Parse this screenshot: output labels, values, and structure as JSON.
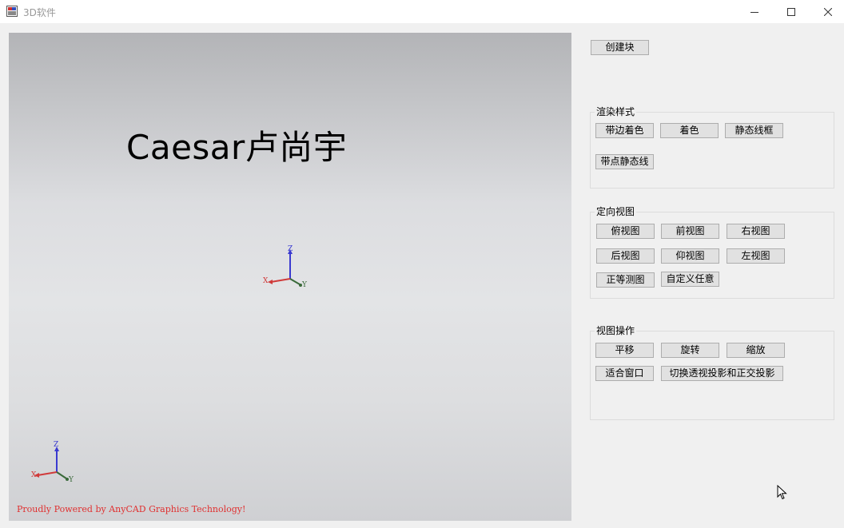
{
  "window": {
    "title": "3D软件",
    "icon": "app-icon",
    "controls": [
      "minimize-icon",
      "maximize-icon",
      "close-icon"
    ]
  },
  "viewport": {
    "overlay_text": "Caesar卢尚宇",
    "powered_by": "Proudly Powered by AnyCAD Graphics Technology!",
    "axis_labels": {
      "x": "X",
      "y": "Y",
      "z": "Z"
    },
    "axis_colors": {
      "x": "#d03a3a",
      "y": "#3a6a3a",
      "z": "#3a3ad0"
    }
  },
  "panel": {
    "create_block": "创建块",
    "render_style": {
      "title": "渲染样式",
      "buttons": [
        "带边着色",
        "着色",
        "静态线框",
        "带点静态线"
      ]
    },
    "view_orientation": {
      "title": "定向视图",
      "buttons": [
        "俯视图",
        "前视图",
        "右视图",
        "后视图",
        "仰视图",
        "左视图",
        "正等测图",
        "自定义任意"
      ]
    },
    "view_ops": {
      "title": "视图操作",
      "buttons": [
        "平移",
        "旋转",
        "缩放",
        "适合窗口",
        "切换透视投影和正交投影"
      ]
    }
  }
}
